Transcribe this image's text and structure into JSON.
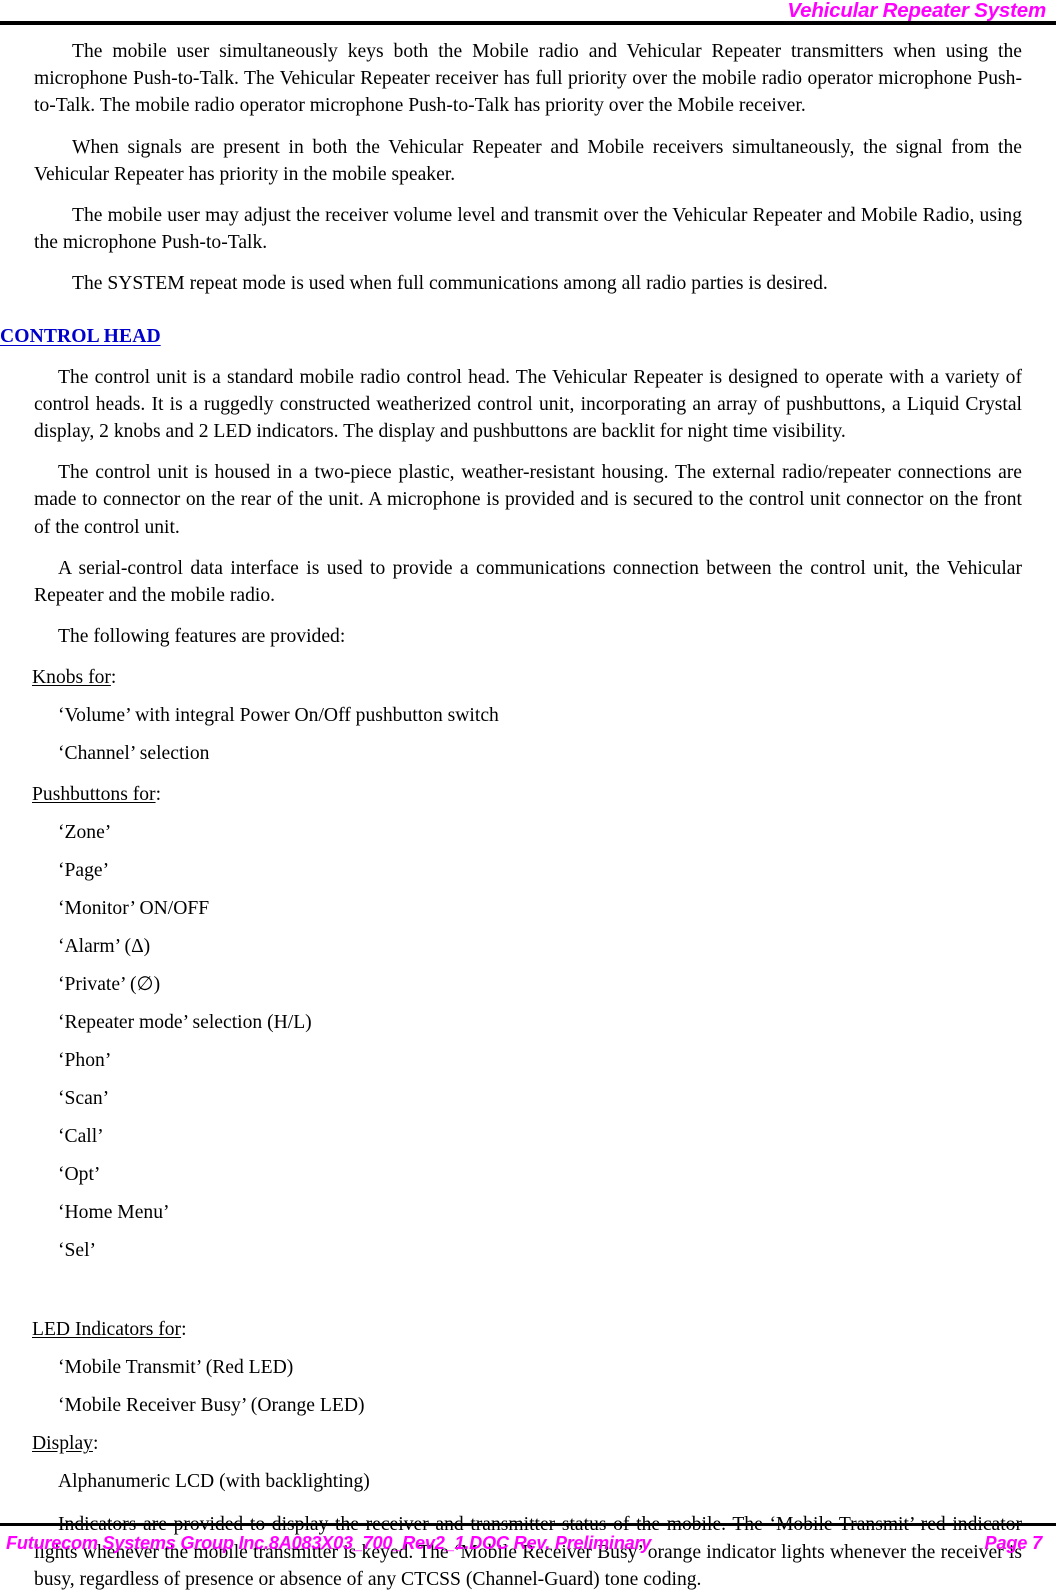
{
  "header": {
    "title": "Vehicular Repeater System",
    "title_color": "#FF00FF"
  },
  "body": {
    "paragraphs_top": [
      "The mobile user simultaneously keys both the Mobile radio and Vehicular Repeater transmitters when using the microphone Push-to-Talk. The Vehicular Repeater receiver has full priority over the mobile radio operator microphone Push-to-Talk. The mobile radio operator microphone Push-to-Talk has priority over the Mobile receiver.",
      "When signals are present in both the Vehicular Repeater and Mobile receivers simultaneously, the signal from the Vehicular Repeater has priority in the mobile speaker.",
      "The mobile user may adjust the receiver volume level and transmit over the Vehicular Repeater and Mobile Radio, using the microphone Push-to-Talk.",
      "The SYSTEM repeat mode is used when full communications among all radio parties is desired."
    ],
    "section_heading": "CONTROL HEAD",
    "section_heading_color": "#0000CC",
    "paragraphs_control_head": [
      "The control unit is a standard mobile radio control head. The Vehicular Repeater is designed to operate with a variety of control heads. It is a ruggedly constructed weatherized control unit, incorporating an array of pushbuttons, a Liquid Crystal display, 2 knobs and 2 LED indicators. The display and pushbuttons are backlit for night time visibility.",
      "The control unit is housed in a two-piece plastic, weather-resistant housing. The external radio/repeater connections are made to connector on the rear of the unit. A microphone is provided and is secured to the control unit connector on the front of the control unit.",
      "A serial-control data interface is used to provide a communications connection between the control unit, the Vehicular Repeater and the mobile radio.",
      "The following features are provided:"
    ],
    "knobs": {
      "label_underlined": "Knobs for",
      "label_suffix": ":",
      "items": [
        "‘Volume’ with integral Power On/Off pushbutton switch",
        "‘Channel’ selection"
      ]
    },
    "pushbuttons": {
      "label_underlined": "Pushbuttons for",
      "label_suffix": ":",
      "items": [
        "‘Zone’",
        "‘Page’",
        "‘Monitor’ ON/OFF",
        "‘Alarm’ (Δ)",
        "‘Private’ (∅)",
        "‘Repeater mode’ selection (H/L)",
        "‘Phon’",
        "‘Scan’",
        "‘Call’",
        "‘Opt’",
        "‘Home Menu’",
        "‘Sel’"
      ]
    },
    "led_indicators": {
      "label_underlined": "LED Indicators for",
      "label_suffix": ":",
      "items": [
        "‘Mobile Transmit’ (Red LED)",
        "‘Mobile Receiver Busy’ (Orange LED)"
      ]
    },
    "display": {
      "label_underlined": "Display",
      "label_suffix": ":",
      "items": [
        "Alphanumeric LCD (with backlighting)"
      ]
    },
    "closing_paragraph": "Indicators are provided to display the receiver and transmitter status of the mobile. The ‘Mobile Transmit’ red indicator lights whenever the mobile transmitter is keyed. The ‘Mobile Receiver Busy’ orange indicator lights whenever the receiver is busy, regardless of presence or absence of any CTCSS (Channel-Guard) tone coding."
  },
  "footer": {
    "left": "Futurecom Systems Group Inc.8A083X03_700_Rev2_1.DOC Rev. Preliminary",
    "right": "Page 7",
    "color": "#FF00FF"
  }
}
